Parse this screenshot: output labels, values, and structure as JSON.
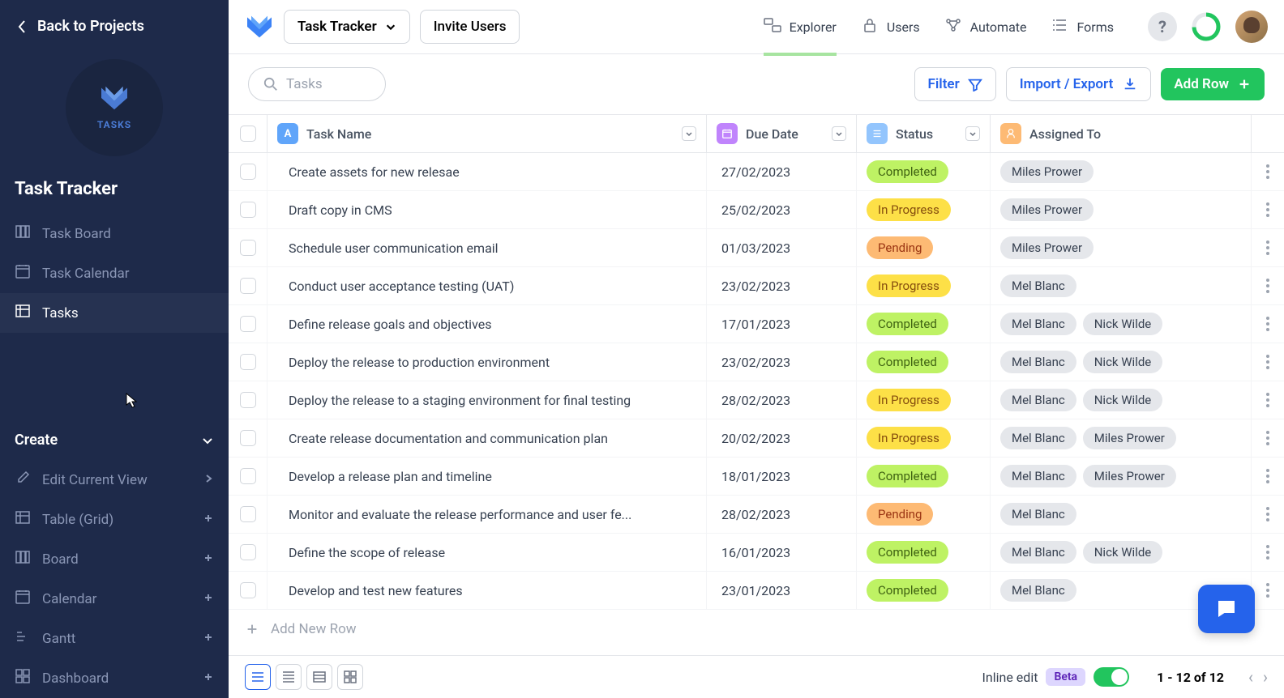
{
  "sidebar": {
    "back": "Back to Projects",
    "logo_label": "TASKS",
    "title": "Task Tracker",
    "nav": [
      {
        "label": "Task Board",
        "active": false
      },
      {
        "label": "Task Calendar",
        "active": false
      },
      {
        "label": "Tasks",
        "active": true
      }
    ],
    "create": "Create",
    "actions": [
      {
        "label": "Edit Current View"
      },
      {
        "label": "Table (Grid)"
      },
      {
        "label": "Board"
      },
      {
        "label": "Calendar"
      },
      {
        "label": "Gantt"
      },
      {
        "label": "Dashboard"
      }
    ]
  },
  "topbar": {
    "dropdown": "Task Tracker",
    "invite": "Invite Users",
    "nav": [
      {
        "label": "Explorer"
      },
      {
        "label": "Users"
      },
      {
        "label": "Automate"
      },
      {
        "label": "Forms"
      }
    ]
  },
  "toolbar": {
    "search_placeholder": "Tasks",
    "filter": "Filter",
    "import": "Import / Export",
    "add_row": "Add Row"
  },
  "columns": {
    "name": "Task Name",
    "date": "Due Date",
    "status": "Status",
    "assigned": "Assigned To"
  },
  "rows": [
    {
      "name": "Create assets for new relesae",
      "date": "27/02/2023",
      "status": "Completed",
      "assigned": [
        "Miles Prower"
      ]
    },
    {
      "name": "Draft copy in CMS",
      "date": "25/02/2023",
      "status": "In Progress",
      "assigned": [
        "Miles Prower"
      ]
    },
    {
      "name": "Schedule user communication email",
      "date": "01/03/2023",
      "status": "Pending",
      "assigned": [
        "Miles Prower"
      ]
    },
    {
      "name": "Conduct user acceptance testing (UAT)",
      "date": "23/02/2023",
      "status": "In Progress",
      "assigned": [
        "Mel Blanc"
      ]
    },
    {
      "name": "Define release goals and objectives",
      "date": "17/01/2023",
      "status": "Completed",
      "assigned": [
        "Mel Blanc",
        "Nick Wilde"
      ]
    },
    {
      "name": "Deploy the release to production environment",
      "date": "23/02/2023",
      "status": "Completed",
      "assigned": [
        "Mel Blanc",
        "Nick Wilde"
      ]
    },
    {
      "name": "Deploy the release to a staging environment for final testing",
      "date": "28/02/2023",
      "status": "In Progress",
      "assigned": [
        "Mel Blanc",
        "Nick Wilde"
      ]
    },
    {
      "name": "Create release documentation and communication plan",
      "date": "20/02/2023",
      "status": "In Progress",
      "assigned": [
        "Mel Blanc",
        "Miles Prower"
      ]
    },
    {
      "name": "Develop a release plan and timeline",
      "date": "18/01/2023",
      "status": "Completed",
      "assigned": [
        "Mel Blanc",
        "Miles Prower"
      ]
    },
    {
      "name": "Monitor and evaluate the release performance and user fe...",
      "date": "28/02/2023",
      "status": "Pending",
      "assigned": [
        "Mel Blanc"
      ]
    },
    {
      "name": "Define the scope of release",
      "date": "16/01/2023",
      "status": "Completed",
      "assigned": [
        "Mel Blanc",
        "Nick Wilde"
      ]
    },
    {
      "name": "Develop and test new features",
      "date": "23/01/2023",
      "status": "Completed",
      "assigned": [
        "Mel Blanc"
      ]
    }
  ],
  "add_new_row": "Add New Row",
  "footer": {
    "inline_edit": "Inline edit",
    "beta": "Beta",
    "pagination": "1 - 12 of 12"
  }
}
